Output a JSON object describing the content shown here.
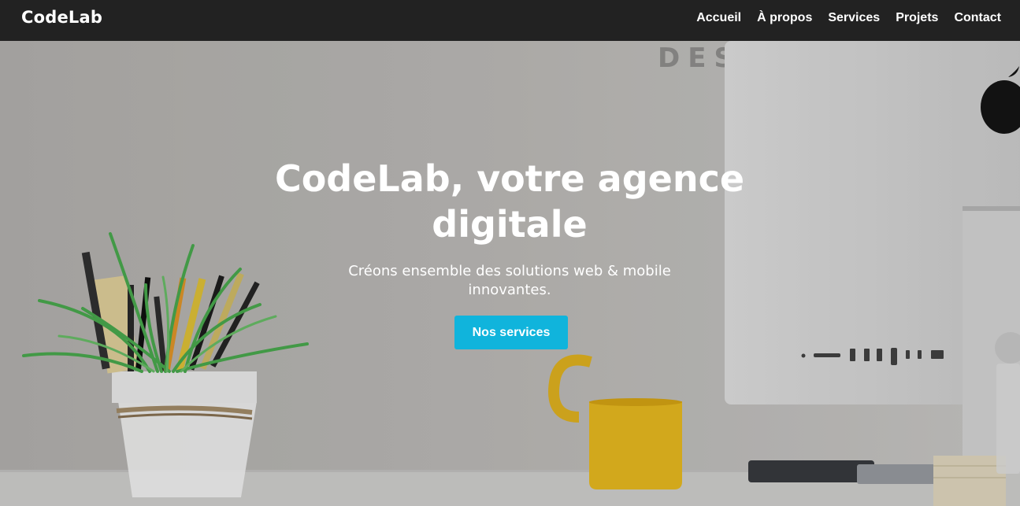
{
  "navbar": {
    "brand": "CodeLab",
    "links": [
      "Accueil",
      "À propos",
      "Services",
      "Projets",
      "Contact"
    ]
  },
  "hero": {
    "title": "CodeLab, votre agence digitale",
    "subtitle": "Créons ensemble des solutions web & mobile innovantes.",
    "cta_label": "Nos services",
    "background_text": "DES"
  },
  "colors": {
    "navbar_bg": "#222222",
    "accent": "#10b4dc",
    "mug": "#f0c020",
    "text": "#ffffff"
  }
}
